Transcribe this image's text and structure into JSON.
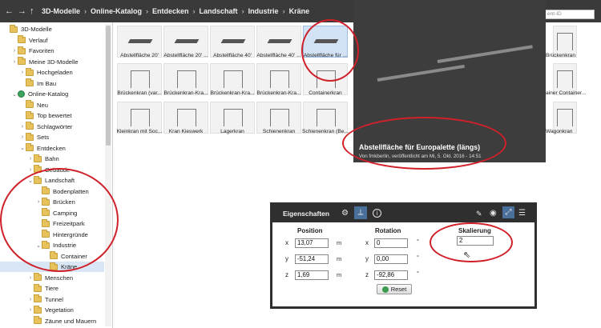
{
  "breadcrumb": {
    "items": [
      "3D-Modelle",
      "Online-Katalog",
      "Entdecken",
      "Landschaft",
      "Industrie",
      "Kräne"
    ],
    "separator": "›"
  },
  "search": {
    "placeholder": "ent-ID"
  },
  "tree": {
    "items": [
      {
        "label": "3D-Modelle",
        "arrow": "",
        "icon": "folder-icon"
      },
      {
        "label": "Verlauf",
        "arrow": "",
        "icon": "folder-icon"
      },
      {
        "label": "Favoriten",
        "arrow": "›",
        "icon": "folder-icon"
      },
      {
        "label": "Meine 3D-Modelle",
        "arrow": "›",
        "icon": "folder-icon"
      },
      {
        "label": "Hochgeladen",
        "arrow": "›",
        "icon": "folder-icon"
      },
      {
        "label": "Im Bau",
        "arrow": "",
        "icon": "folder-icon"
      },
      {
        "label": "Online-Katalog",
        "arrow": "⌄",
        "icon": "globe-icon"
      },
      {
        "label": "Neu",
        "arrow": "",
        "icon": "folder-icon"
      },
      {
        "label": "Top bewertet",
        "arrow": "",
        "icon": "folder-icon"
      },
      {
        "label": "Schlagwörter",
        "arrow": "›",
        "icon": "folder-icon"
      },
      {
        "label": "Sets",
        "arrow": "›",
        "icon": "folder-icon"
      },
      {
        "label": "Entdecken",
        "arrow": "⌄",
        "icon": "folder-icon"
      },
      {
        "label": "Bahn",
        "arrow": "›",
        "icon": "folder-icon"
      },
      {
        "label": "Gebäude",
        "arrow": "›",
        "icon": "folder-icon"
      },
      {
        "label": "Landschaft",
        "arrow": "⌄",
        "icon": "folder-icon"
      },
      {
        "label": "Bodenplatten",
        "arrow": "",
        "icon": "folder-icon"
      },
      {
        "label": "Brücken",
        "arrow": "›",
        "icon": "folder-icon"
      },
      {
        "label": "Camping",
        "arrow": "",
        "icon": "folder-icon"
      },
      {
        "label": "Freizeitpark",
        "arrow": "",
        "icon": "folder-icon"
      },
      {
        "label": "Hintergründe",
        "arrow": "",
        "icon": "folder-icon"
      },
      {
        "label": "Industrie",
        "arrow": "⌄",
        "icon": "folder-icon"
      },
      {
        "label": "Container",
        "arrow": "",
        "icon": "folder-icon"
      },
      {
        "label": "Kräne",
        "arrow": "",
        "icon": "folder-icon"
      },
      {
        "label": "Menschen",
        "arrow": "›",
        "icon": "folder-icon"
      },
      {
        "label": "Tiere",
        "arrow": "",
        "icon": "folder-icon"
      },
      {
        "label": "Tunnel",
        "arrow": "›",
        "icon": "folder-icon"
      },
      {
        "label": "Vegetation",
        "arrow": "›",
        "icon": "folder-icon"
      },
      {
        "label": "Zäune und Mauern",
        "arrow": "",
        "icon": "folder-icon"
      }
    ]
  },
  "grid": {
    "row1": [
      "Abstellfläche 20'",
      "Abstellfläche 20' ...",
      "Abstellfläche 40'",
      "Abstellfläche 40' ...",
      "Abstellfläche für ..."
    ],
    "row2": [
      "Brückenkran (var...",
      "Brückenkran-Kra...",
      "Brückenkran-Kra...",
      "Brückenkran-Kra...",
      "Containerkran"
    ],
    "row3": [
      "Kleinkran mit Soc...",
      "Kran Kieswerk",
      "Lagerkran",
      "Schienenkran",
      "Schienenkran (Be..."
    ],
    "right_col": [
      "Brückenkran",
      "ainer Container...",
      "Wagonkran"
    ]
  },
  "preview": {
    "title": "Abstellfläche für Europalette (längs)",
    "subtitle": "Von fmkberlin, veröffentlicht am Mi, 5. Okt. 2016 - 14:51"
  },
  "props": {
    "title": "Eigenschaften",
    "columns": {
      "position": "Position",
      "rotation": "Rotation",
      "scale": "Skalierung"
    },
    "axes": [
      "x",
      "y",
      "z"
    ],
    "position": [
      "13,07",
      "-51,24",
      "1,69"
    ],
    "rotation": [
      "0",
      "0,00",
      "-92,86"
    ],
    "position_unit": "m",
    "rotation_unit": "°",
    "scale": "2",
    "reset_label": "Reset"
  },
  "colors": {
    "dark_bar": "#3a3a3a",
    "annotation_red": "#d0202a",
    "selection": "#d8e6f6",
    "hover_tile": "#d3e3f5"
  }
}
